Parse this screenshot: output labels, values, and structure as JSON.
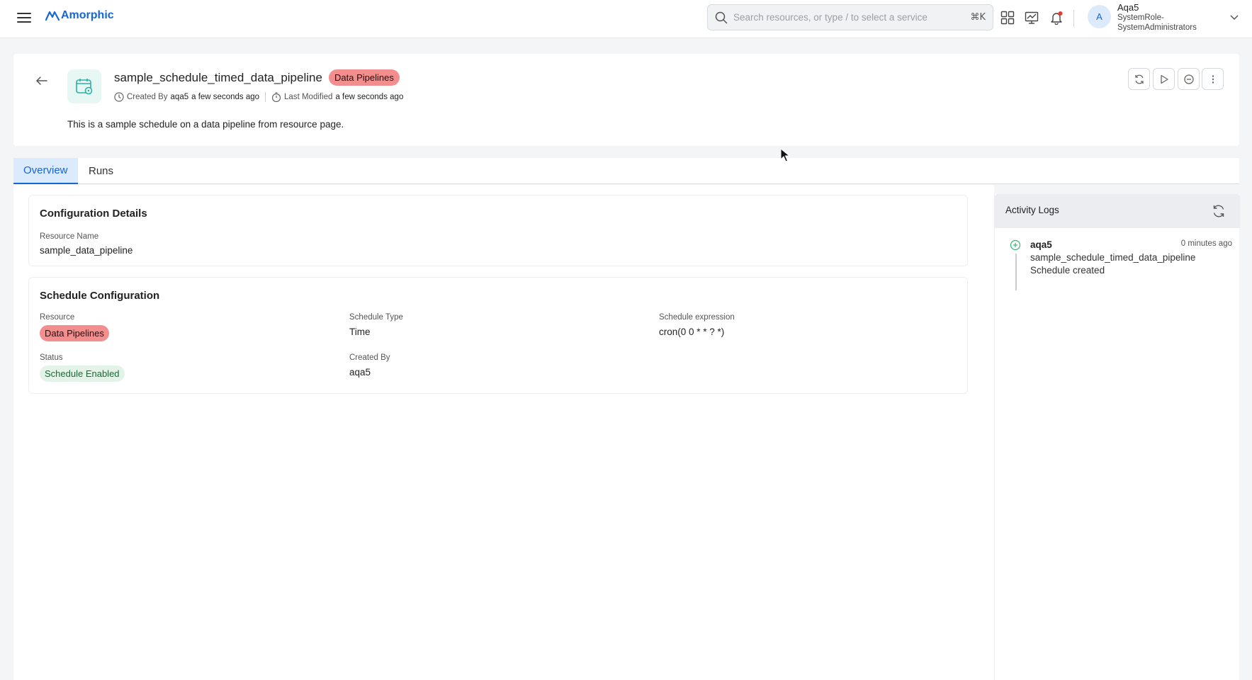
{
  "app": {
    "logo_text": "Amorphic"
  },
  "search": {
    "placeholder": "Search resources, or type / to select a service",
    "shortcut": "⌘K"
  },
  "user": {
    "avatar_initial": "A",
    "name": "Aqa5",
    "role": "SystemRole-SystemAdministrators"
  },
  "header": {
    "title": "sample_schedule_timed_data_pipeline",
    "badge": "Data Pipelines",
    "created_by_label": "Created By",
    "created_by_user": "aqa5",
    "created_time": "a few seconds ago",
    "modified_label": "Last Modified",
    "modified_time": "a few seconds ago",
    "description": "This is a sample schedule on a data pipeline from resource page."
  },
  "tabs": [
    {
      "label": "Overview",
      "active": true
    },
    {
      "label": "Runs",
      "active": false
    }
  ],
  "config_details": {
    "title": "Configuration Details",
    "resource_name_label": "Resource Name",
    "resource_name_value": "sample_data_pipeline"
  },
  "schedule_config": {
    "title": "Schedule Configuration",
    "resource_label": "Resource",
    "resource_value": "Data Pipelines",
    "schedule_type_label": "Schedule Type",
    "schedule_type_value": "Time",
    "expression_label": "Schedule expression",
    "expression_value": "cron(0 0 * * ? *)",
    "status_label": "Status",
    "status_value": "Schedule Enabled",
    "created_by_label": "Created By",
    "created_by_value": "aqa5"
  },
  "activity_logs": {
    "title": "Activity Logs",
    "entries": [
      {
        "user": "aqa5",
        "time": "0 minutes ago",
        "resource": "sample_schedule_timed_data_pipeline",
        "action": "Schedule created"
      }
    ]
  },
  "colors": {
    "brand": "#1766d6",
    "badge_red": "#f38e8e",
    "badge_green_bg": "#e3f3e7",
    "badge_green_text": "#176b35",
    "log_icon": "#3cb371"
  },
  "icons": {
    "menu": "hamburger-icon",
    "search": "search-icon",
    "apps": "grid-icon",
    "monitor": "chart-icon",
    "notifications": "bell-icon",
    "back": "arrow-left-icon",
    "resource": "calendar-gear-icon",
    "refresh": "refresh-icon",
    "run": "play-icon",
    "disable": "minus-circle-icon",
    "more": "kebab-icon"
  }
}
